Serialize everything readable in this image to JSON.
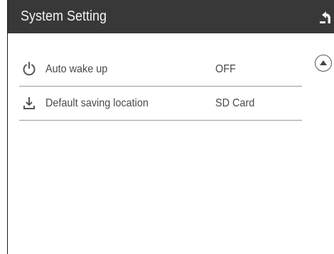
{
  "header": {
    "title": "System Setting",
    "back_icon": "return-arrow-icon",
    "background_color": "#383838"
  },
  "settings": {
    "items": [
      {
        "label": "Auto wake up",
        "value": "OFF",
        "icon": "power-icon"
      },
      {
        "label": "Default saving location",
        "value": "SD Card",
        "icon": "download-icon"
      }
    ]
  },
  "scroll": {
    "icon": "scroll-up-icon"
  }
}
